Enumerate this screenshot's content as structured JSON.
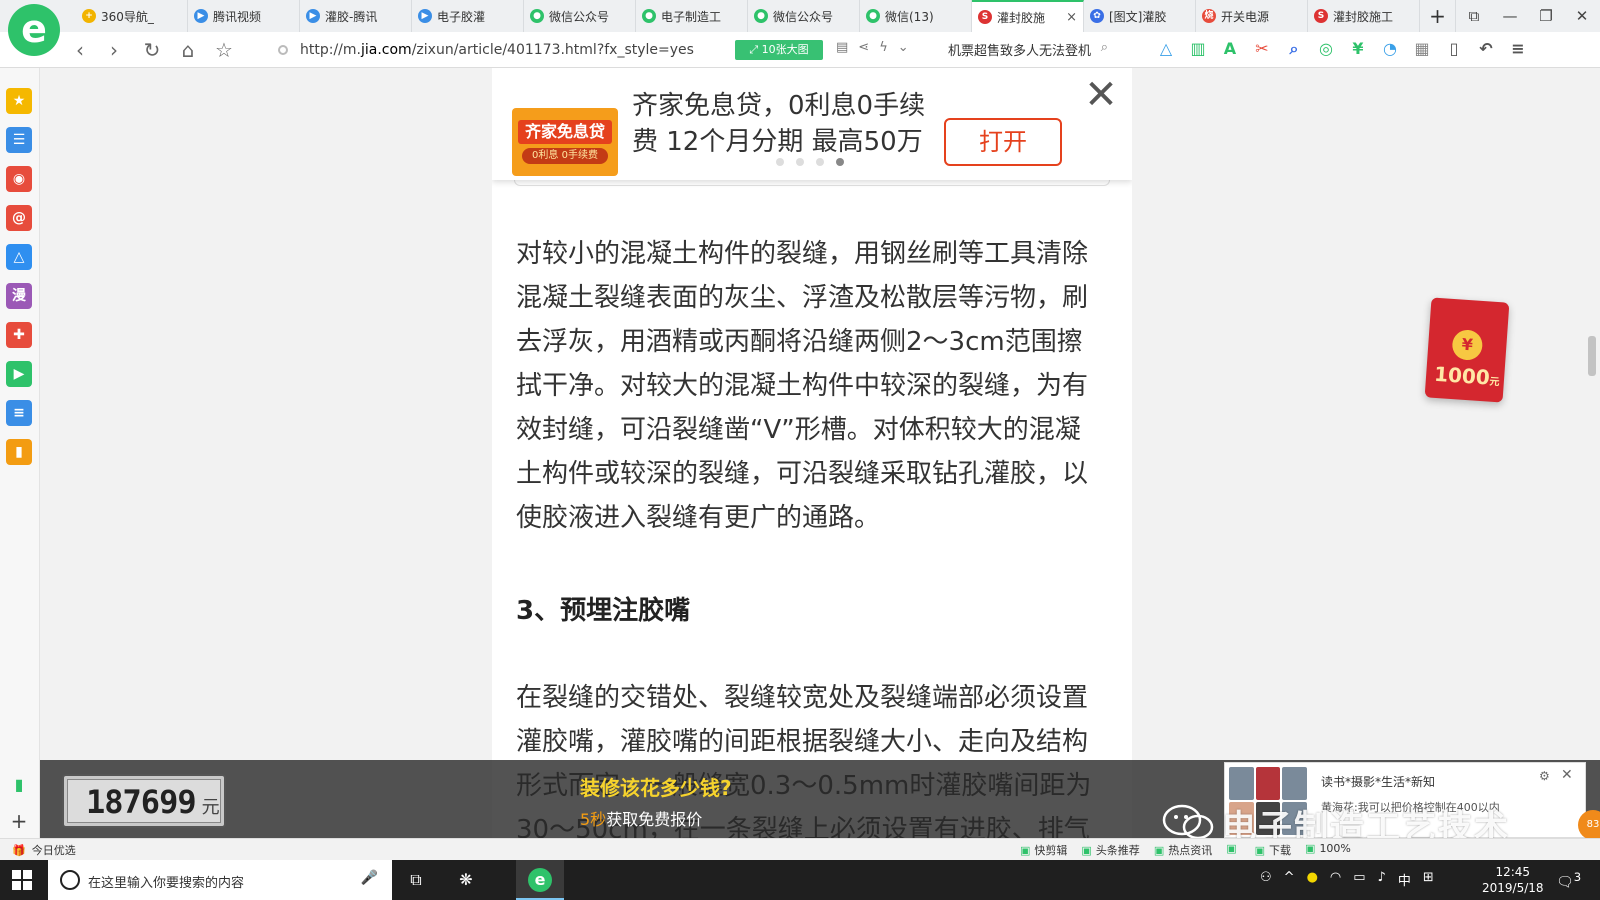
{
  "browser": {
    "logo": "e",
    "tabs": [
      {
        "label": "360导航_",
        "icon_color": "#f2b400",
        "glyph": "+"
      },
      {
        "label": "腾讯视频",
        "icon_color": "#3a8ee6",
        "glyph": "▶"
      },
      {
        "label": "灌胶-腾讯",
        "icon_color": "#3a8ee6",
        "glyph": "▶"
      },
      {
        "label": "电子胶灌",
        "icon_color": "#3a8ee6",
        "glyph": "▶"
      },
      {
        "label": "微信公众号",
        "icon_color": "#2ec26a",
        "glyph": "●"
      },
      {
        "label": "电子制造工",
        "icon_color": "#2ec26a",
        "glyph": "●"
      },
      {
        "label": "微信公众号",
        "icon_color": "#2ec26a",
        "glyph": "●"
      },
      {
        "label": "微信(13)",
        "icon_color": "#2ec26a",
        "glyph": "●"
      },
      {
        "label": "灌封胶施",
        "icon_color": "#d33",
        "glyph": "S",
        "active": true
      },
      {
        "label": "[图文]灌胶",
        "icon_color": "#3a6fe6",
        "glyph": "✿"
      },
      {
        "label": "开关电源",
        "icon_color": "#e74c3c",
        "glyph": "烧"
      },
      {
        "label": "灌封胶施工",
        "icon_color": "#d33",
        "glyph": "S"
      }
    ],
    "tab_close": "×",
    "new_tab": "+",
    "window_controls": [
      "⧉",
      "—",
      "❐",
      "✕"
    ],
    "url_prefix": "http://m.",
    "url_domain": "jia.com",
    "url_path": "/zixun/article/401173.html?fx_style=yes",
    "big_pic_label": "10张大图",
    "search_text": "机票超售致多人无法登机",
    "tool_colors": [
      "#3aa0e8",
      "#2ec26a",
      "#2ec26a",
      "#e74c3c",
      "#3a6fe6",
      "#2ec26a",
      "#2ec26a",
      "#3aa0e8",
      "#888",
      "#555",
      "#555",
      "#555"
    ]
  },
  "sidebar": {
    "items": [
      {
        "glyph": "★",
        "color": "#f5b800"
      },
      {
        "glyph": "☰",
        "color": "#3a8ee6"
      },
      {
        "glyph": "◉",
        "color": "#e74c3c"
      },
      {
        "glyph": "@",
        "color": "#e74c3c"
      },
      {
        "glyph": "△",
        "color": "#2f8ff0"
      },
      {
        "glyph": "漫",
        "color": "#9b59b6"
      },
      {
        "glyph": "✚",
        "color": "#e74c3c"
      },
      {
        "glyph": "▶",
        "color": "#2ec26a"
      },
      {
        "glyph": "≡",
        "color": "#3a8ee6"
      },
      {
        "glyph": "▮",
        "color": "#f39c12"
      }
    ],
    "bottom": [
      "▮",
      "+"
    ]
  },
  "ad": {
    "thumb_title": "齐家免息贷",
    "thumb_sub": "0利息 0手续费",
    "text": "齐家免息贷，0利息0手续费 12个月分期 最高50万",
    "open_label": "打开",
    "close": "✕"
  },
  "article": {
    "paragraph1": "对较小的混凝土构件的裂缝，用钢丝刷等工具清除混凝土裂缝表面的灰尘、浮渣及松散层等污物，刷去浮灰，用酒精或丙酮将沿缝两侧2～3cm范围擦拭干净。对较大的混凝土构件中较深的裂缝，为有效封缝，可沿裂缝凿“V”形槽。对体积较大的混凝土构件或较深的裂缝，可沿裂缝采取钻孔灌胶，以使胶液进入裂缝有更广的通路。",
    "heading": "3、预埋注胶嘴",
    "paragraph2": "在裂缝的交错处、裂缝较宽处及裂缝端部必须设置灌胶嘴，灌胶嘴的间距根据裂缝大小、走向及结构形式而定，一般缝宽0.3～0.5mm时灌胶嘴间距为30～50cm，在一条裂缝上必须设置有进胶、排气"
  },
  "red_envelope": {
    "coin": "¥",
    "amount": "1000",
    "unit": "元"
  },
  "overlay": {
    "counter_value": "187699",
    "counter_unit": "元",
    "title": "装修该花多少钱?",
    "seconds": "5秒",
    "subtitle": "获取免费报价"
  },
  "news": {
    "title": "读书*摄影*生活*新知",
    "desc": "黄海花:我可以把价格控制在400以内",
    "gear": "⚙",
    "close": "✕"
  },
  "watermark": "电子制造工艺技术",
  "orange_bubble": "83",
  "statusbar": {
    "left": "今日优选",
    "left_icon": "🎁",
    "right": [
      "快剪辑",
      "头条推荐",
      "热点资讯",
      "",
      "下载",
      "100%"
    ]
  },
  "taskbar": {
    "search_placeholder": "在这里输入你要搜索的内容",
    "mic": "🎤",
    "time": "12:45",
    "date": "2019/5/18",
    "ime": "中",
    "tray": [
      "⚇",
      "^",
      "●",
      "◠",
      "▭",
      "♪",
      "中",
      "⊞"
    ],
    "notification": "3"
  }
}
